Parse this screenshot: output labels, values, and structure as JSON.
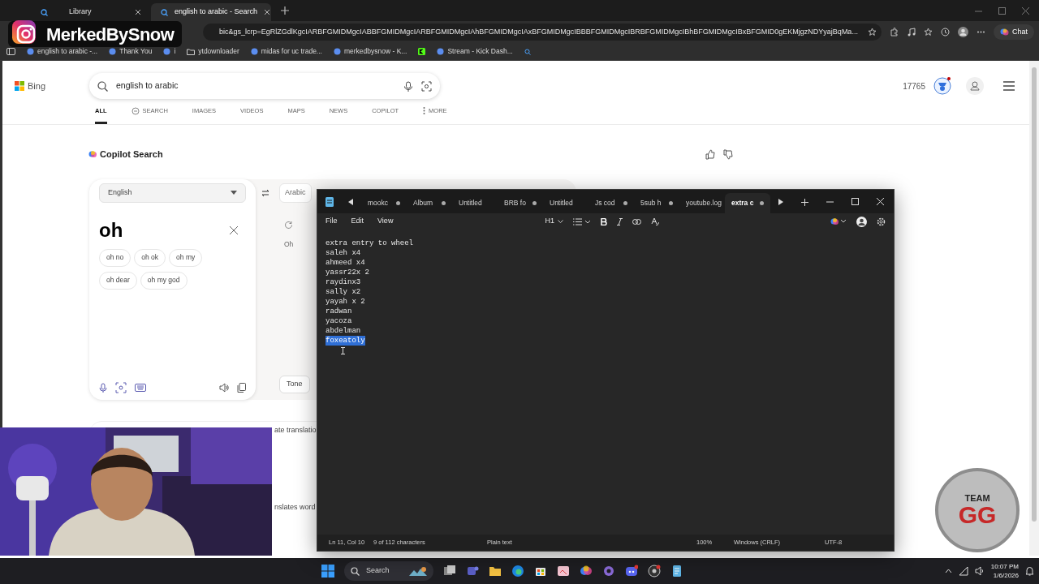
{
  "browser": {
    "tabs": [
      {
        "title": "Library",
        "selected": false
      },
      {
        "title": "english to arabic - Search",
        "selected": true
      }
    ],
    "address": "bic&gs_lcrp=EgRlZGdlKgcIARBFGMIDMgcIABBFGMIDMgcIARBFGMIDMgcIAhBFGMIDMgcIAxBFGMIDMgcIBBBFGMIDMgcIBRBFGMIDMgcIBhBFGMIDMgcIBxBFGMID0gEKMjgzNDYyajBqMa...",
    "bookmarks": [
      {
        "kind": "link",
        "label": "english to arabic -..."
      },
      {
        "kind": "link",
        "label": "Thank You"
      },
      {
        "kind": "link",
        "label": "i"
      },
      {
        "kind": "folder",
        "label": "ytdownloader"
      },
      {
        "kind": "link",
        "label": "midas for uc trade..."
      },
      {
        "kind": "link",
        "label": "merkedbysnow - K..."
      },
      {
        "kind": "icon_only"
      },
      {
        "kind": "link",
        "label": "Stream - Kick Dash..."
      }
    ],
    "chat_button": "Chat"
  },
  "overlay": {
    "handle": "MerkedBySnow"
  },
  "bing": {
    "brand": "Bing",
    "query": "english to arabic",
    "points": "17765",
    "nav": [
      {
        "label": "ALL",
        "selected": true
      },
      {
        "label": "SEARCH",
        "selected": false
      },
      {
        "label": "IMAGES",
        "selected": false
      },
      {
        "label": "VIDEOS",
        "selected": false
      },
      {
        "label": "MAPS",
        "selected": false
      },
      {
        "label": "NEWS",
        "selected": false
      },
      {
        "label": "COPILOT",
        "selected": false
      },
      {
        "label": "MORE",
        "selected": false
      }
    ],
    "section_title": "Copilot Search",
    "source_language": "English",
    "target_language": "Arabic",
    "input_text": "oh",
    "suggestions": [
      "oh no",
      "oh ok",
      "oh my",
      "oh dear",
      "oh my god"
    ],
    "translation": "Oh",
    "tone_button": "Tone",
    "fragments": [
      "ate translatio",
      "nslates word"
    ]
  },
  "notepad": {
    "tabs": [
      {
        "title": "mookc",
        "modified": true,
        "selected": false
      },
      {
        "title": "Album",
        "modified": true,
        "selected": false
      },
      {
        "title": "Untitled",
        "modified": false,
        "selected": false
      },
      {
        "title": "BRB fo",
        "modified": true,
        "selected": false
      },
      {
        "title": "Untitled",
        "modified": false,
        "selected": false
      },
      {
        "title": "Js cod",
        "modified": true,
        "selected": false
      },
      {
        "title": "5sub h",
        "modified": true,
        "selected": false
      },
      {
        "title": "youtube.log",
        "modified": false,
        "selected": false
      },
      {
        "title": "extra c",
        "modified": true,
        "selected": true
      }
    ],
    "menu": [
      "File",
      "Edit",
      "View"
    ],
    "heading_control": "H1",
    "lines": [
      {
        "text": "extra entry to wheel",
        "selected": false
      },
      {
        "text": "saleh x4",
        "selected": false
      },
      {
        "text": "ahmeed x4",
        "selected": false
      },
      {
        "text": "yassr22x 2",
        "selected": false
      },
      {
        "text": "raydinx3",
        "selected": false
      },
      {
        "text": "sally x2",
        "selected": false
      },
      {
        "text": "yayah x 2",
        "selected": false
      },
      {
        "text": "radwan",
        "selected": false
      },
      {
        "text": "yacoza",
        "selected": false
      },
      {
        "text": "abdelman",
        "selected": false
      },
      {
        "text": "foxeatoly",
        "selected": true
      }
    ],
    "status": {
      "position": "Ln 11, Col 10",
      "selection": "9 of 112 characters",
      "format": "Plain text",
      "zoom": "100%",
      "line_endings": "Windows (CRLF)",
      "encoding": "UTF-8"
    }
  },
  "badge": {
    "top": "TEAM",
    "bottom": "GG"
  },
  "taskbar": {
    "search": "Search",
    "time": "10:07 PM",
    "date": "1/6/2026"
  }
}
